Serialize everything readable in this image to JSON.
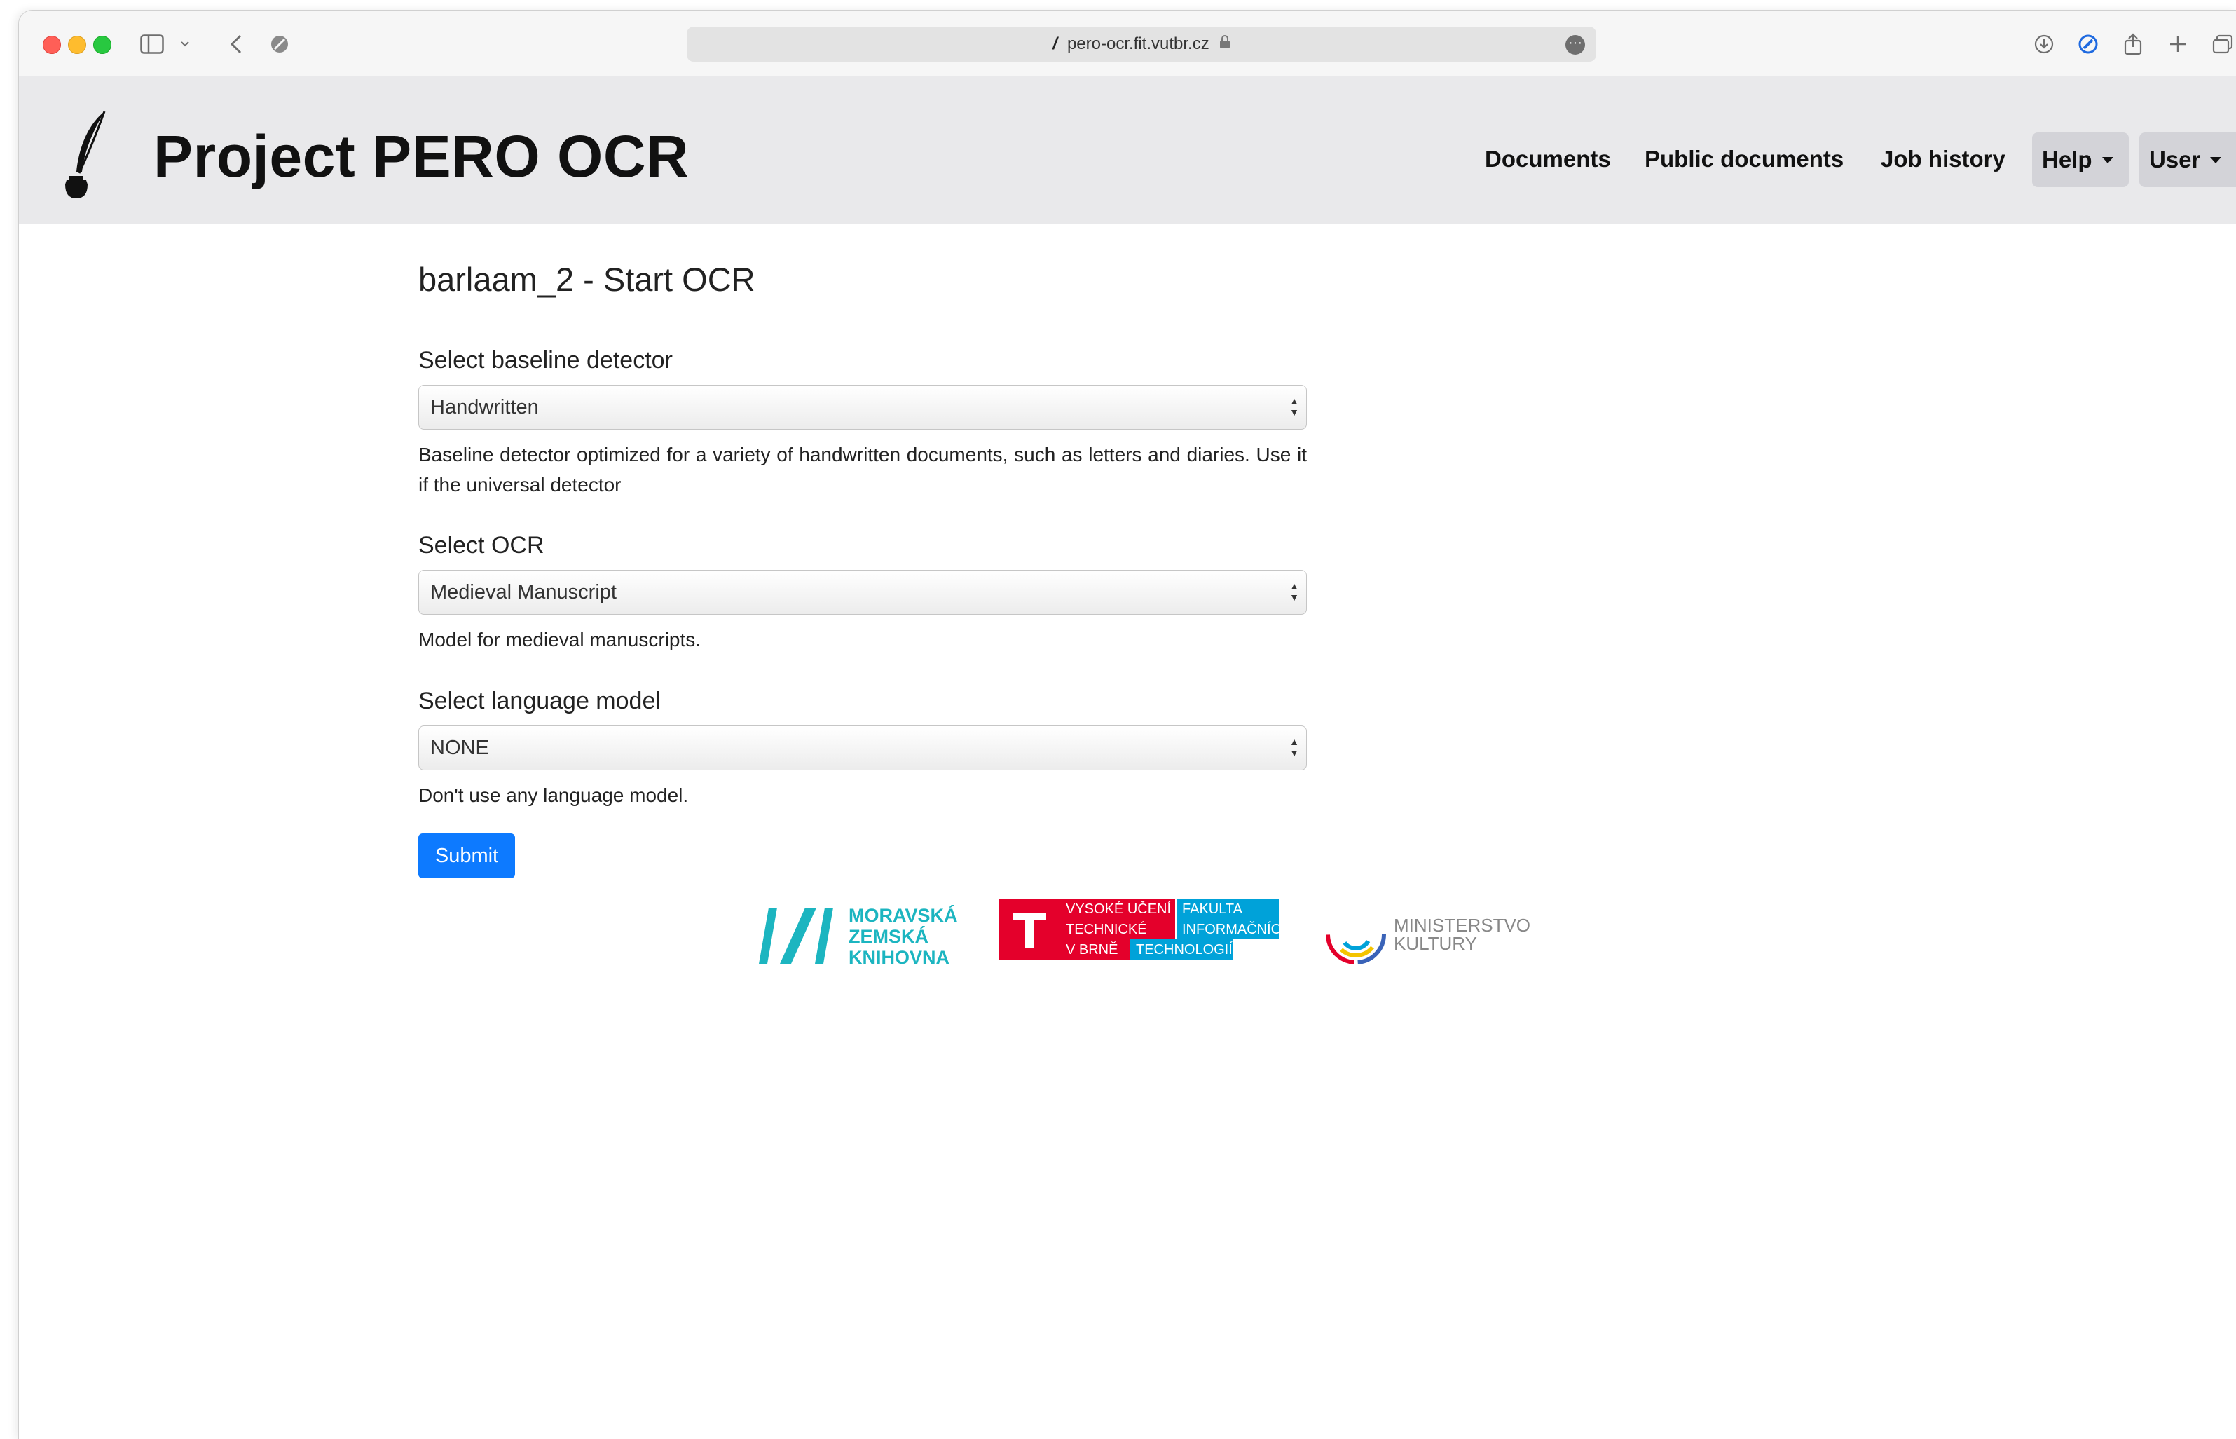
{
  "browser": {
    "url": "pero-ocr.fit.vutbr.cz"
  },
  "site": {
    "brand": "Project PERO OCR",
    "nav": {
      "documents": "Documents",
      "public_documents": "Public documents",
      "job_history": "Job history",
      "help": "Help",
      "user": "User"
    }
  },
  "page": {
    "title": "barlaam_2 - Start OCR",
    "baseline": {
      "label": "Select baseline detector",
      "selected": "Handwritten",
      "description": "Baseline detector optimized for a variety of handwritten documents, such as letters and diaries. Use it if the universal detector"
    },
    "ocr": {
      "label": "Select OCR",
      "selected": "Medieval Manuscript",
      "description": "Model for medieval manuscripts."
    },
    "language_model": {
      "label": "Select language model",
      "selected": "NONE",
      "description": "Don't use any language model."
    },
    "submit_label": "Submit"
  },
  "footer": {
    "mzk": [
      "MORAVSKÁ",
      "ZEMSKÁ",
      "KNIHOVNA"
    ],
    "vut": {
      "left": [
        "VYSOKÉ UČENÍ",
        "TECHNICKÉ",
        "V BRNĚ"
      ],
      "right": [
        "FAKULTA",
        "INFORMAČNÍCH",
        "TECHNOLOGIÍ"
      ]
    },
    "mk": [
      "MINISTERSTVO",
      "KULTURY"
    ]
  },
  "colors": {
    "accent": "#0d7aff",
    "navbar": "#e9e9eb",
    "mzk_teal": "#1cb5c0",
    "vut_red": "#e4002b",
    "vut_blue": "#00a2d9"
  }
}
